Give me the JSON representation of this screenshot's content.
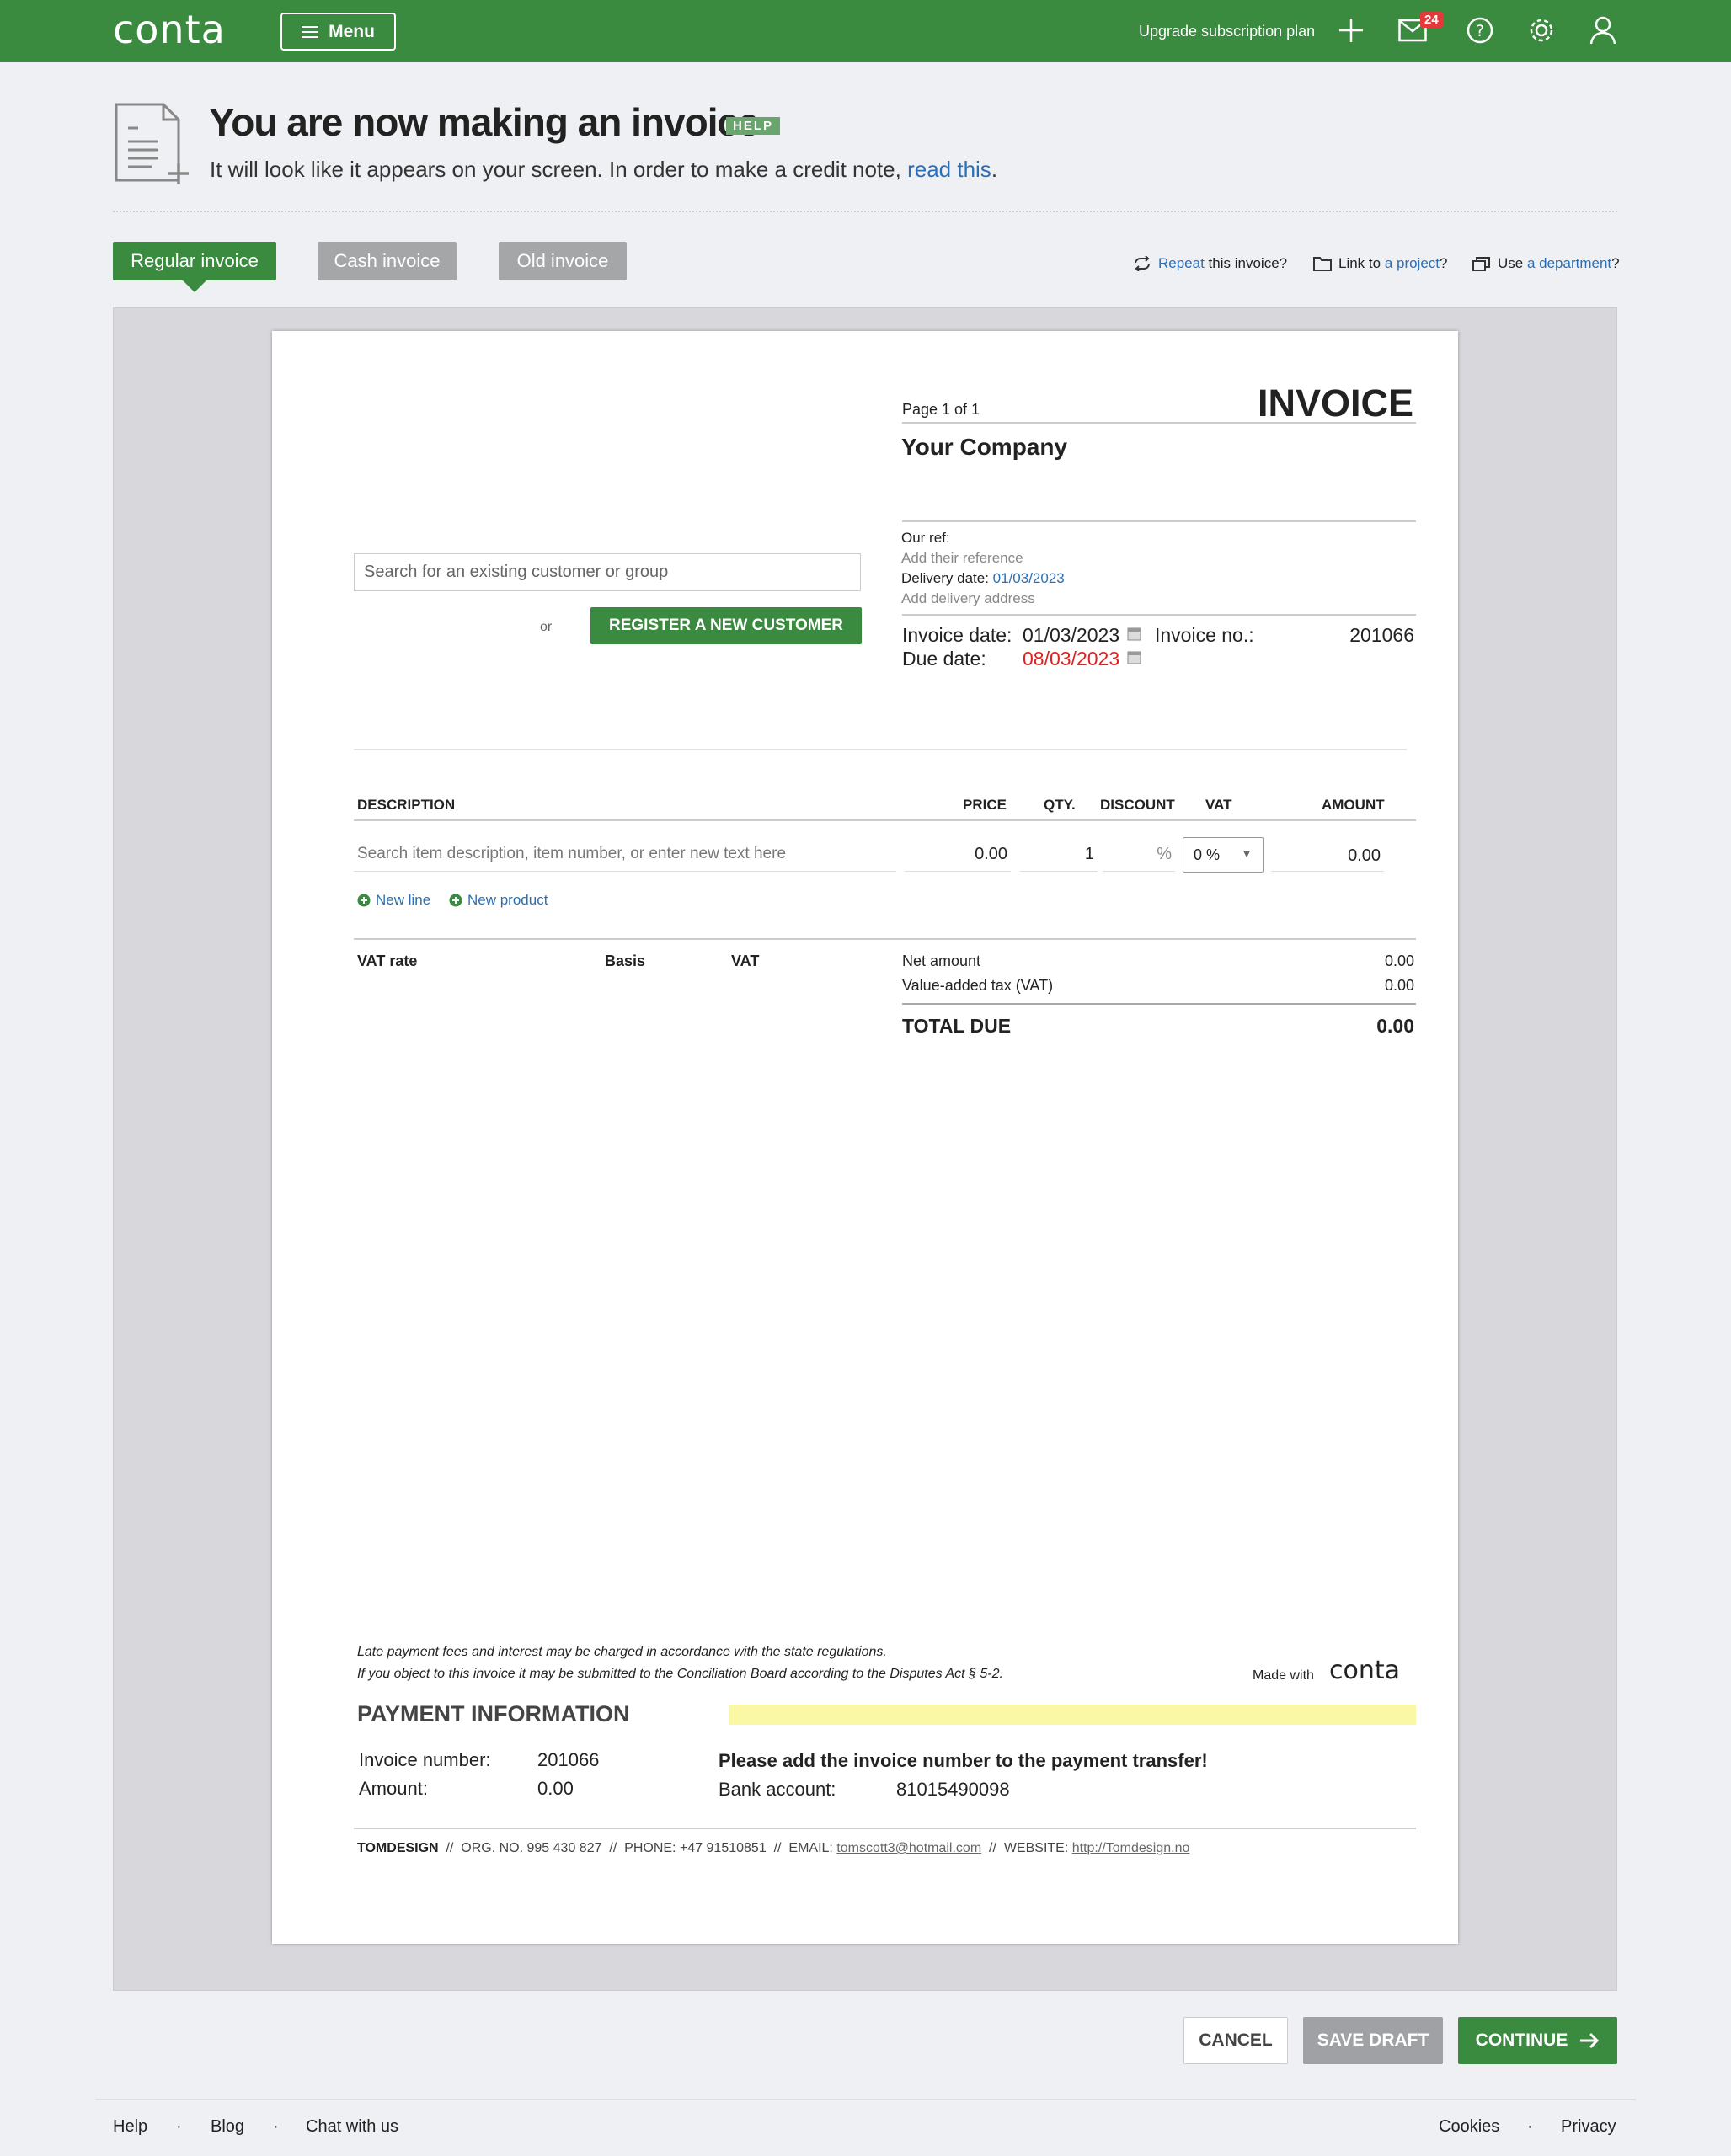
{
  "app": {
    "logo": "conta"
  },
  "topbar": {
    "menu_label": "Menu",
    "upgrade_label": "Upgrade subscription plan",
    "mail_badge": "24",
    "accent": "#3a8a3f"
  },
  "header": {
    "title": "You are now making an invoice",
    "help_tag": "HELP",
    "subtitle_prefix": "It will look like it appears on your screen. In order to make a credit note, ",
    "subtitle_link": "read this",
    "subtitle_suffix": "."
  },
  "tabs": [
    {
      "label": "Regular invoice",
      "active": true
    },
    {
      "label": "Cash invoice",
      "active": false
    },
    {
      "label": "Old invoice",
      "active": false
    }
  ],
  "options": {
    "repeat_link": "Repeat",
    "repeat_text": " this invoice?",
    "project_text": "Link to ",
    "project_link": "a project",
    "project_suffix": "?",
    "department_text": "Use ",
    "department_link": "a department",
    "department_suffix": "?"
  },
  "invoice": {
    "page_label": "Page 1 of 1",
    "heading": "INVOICE",
    "company": "Your Company",
    "customer_search_placeholder": "Search for an existing customer or group",
    "or_label": "or",
    "register_button": "REGISTER A NEW CUSTOMER",
    "our_ref_label": "Our ref:",
    "their_ref_link": "Add their reference",
    "delivery_date_label": "Delivery date:",
    "delivery_date": "01/03/2023",
    "delivery_address_link": "Add delivery address",
    "invoice_date_label": "Invoice date:",
    "invoice_date": "01/03/2023",
    "invoice_no_label": "Invoice no.:",
    "invoice_no": "201066",
    "due_date_label": "Due date:",
    "due_date": "08/03/2023",
    "columns": {
      "description": "DESCRIPTION",
      "price": "PRICE",
      "qty": "QTY.",
      "discount": "DISCOUNT",
      "vat": "VAT",
      "amount": "AMOUNT"
    },
    "line": {
      "description_placeholder": "Search item description, item number, or enter new text here",
      "price": "0.00",
      "qty": "1",
      "discount_unit": "%",
      "vat": "0 %",
      "amount": "0.00"
    },
    "new_line": "New line",
    "new_product": "New product",
    "vat_table": {
      "rate": "VAT rate",
      "basis": "Basis",
      "vat": "VAT"
    },
    "totals": {
      "net_label": "Net amount",
      "net": "0.00",
      "vat_label": "Value-added tax (VAT)",
      "vat": "0.00",
      "total_label": "TOTAL DUE",
      "total": "0.00"
    },
    "legal_1": "Late payment fees and interest may be charged in accordance with the state regulations.",
    "legal_2": "If you object to this invoice it may be submitted to the Conciliation Board according to the Disputes Act § 5-2.",
    "made_with": "Made with",
    "made_with_logo": "conta",
    "payment_heading": "PAYMENT INFORMATION",
    "pay_invoice_number_label": "Invoice number:",
    "pay_invoice_number": "201066",
    "pay_amount_label": "Amount:",
    "pay_amount": "0.00",
    "pay_notice": "Please add the invoice number to the payment transfer!",
    "bank_label": "Bank account:",
    "bank_account": "81015490098",
    "footer_company": "TOMDESIGN",
    "footer_org": "//  ORG. NO. 995 430 827  //  PHONE: +47 91510851  //  EMAIL: ",
    "footer_email": "tomscott3@hotmail.com",
    "footer_web_label": "  //  WEBSITE: ",
    "footer_web": "http://Tomdesign.no"
  },
  "actions": {
    "cancel": "CANCEL",
    "save_draft": "SAVE DRAFT",
    "continue": "CONTINUE"
  },
  "footer": {
    "links_left": [
      "Help",
      "Blog",
      "Chat with us"
    ],
    "links_right": [
      "Cookies",
      "Privacy"
    ],
    "separator": "·"
  }
}
